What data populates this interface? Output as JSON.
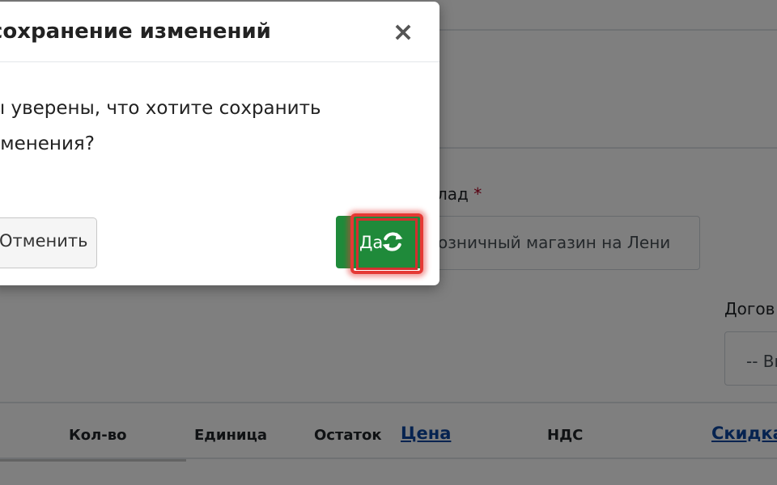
{
  "form": {
    "sklad_label": "лад",
    "required_mark": "*",
    "sklad_value": "озничный магазин на Лени",
    "dogovor_label": "Догов",
    "dogovor_value": "-- Вы"
  },
  "table": {
    "headers": [
      "Кол-во",
      "Единица",
      "Остаток",
      "Цена",
      "НДС",
      "Скидка"
    ]
  },
  "dialog": {
    "title": "сохранение изменений",
    "message_line1": "ы уверены, что хотите сохранить",
    "message_line2": "зменения?",
    "cancel_label": "Отменить",
    "confirm_label": "Да",
    "close_glyph": "×",
    "confirm_color": "#1f8a3a",
    "highlight_color": "#e53935",
    "icons": {
      "close": "close-icon",
      "confirm": "refresh-icon"
    }
  }
}
